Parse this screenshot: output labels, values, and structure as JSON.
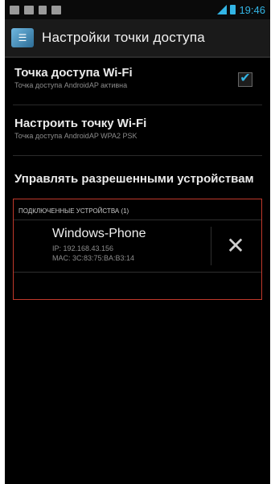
{
  "status_bar": {
    "time": "19:46",
    "accent_color": "#33b5e5"
  },
  "action_bar": {
    "title": "Настройки точки доступа"
  },
  "prefs": [
    {
      "title": "Точка доступа Wi-Fi",
      "summary": "Точка доступа AndroidAP активна",
      "checked": true
    },
    {
      "title": "Настроить точку Wi-Fi",
      "summary": "Точка доступа AndroidAP WPA2 PSK"
    }
  ],
  "manage_devices_label": "Управлять разрешенными устройствам",
  "connected_section": {
    "header": "ПОДКЛЮЧЕННЫЕ УСТРОЙСТВА (1)",
    "devices": [
      {
        "name": "Windows-Phone",
        "ip": "IP: 192.168.43.156",
        "mac": "MAC: 3C:83:75:BA:B3:14"
      }
    ]
  },
  "highlight_color": "#c0392b"
}
